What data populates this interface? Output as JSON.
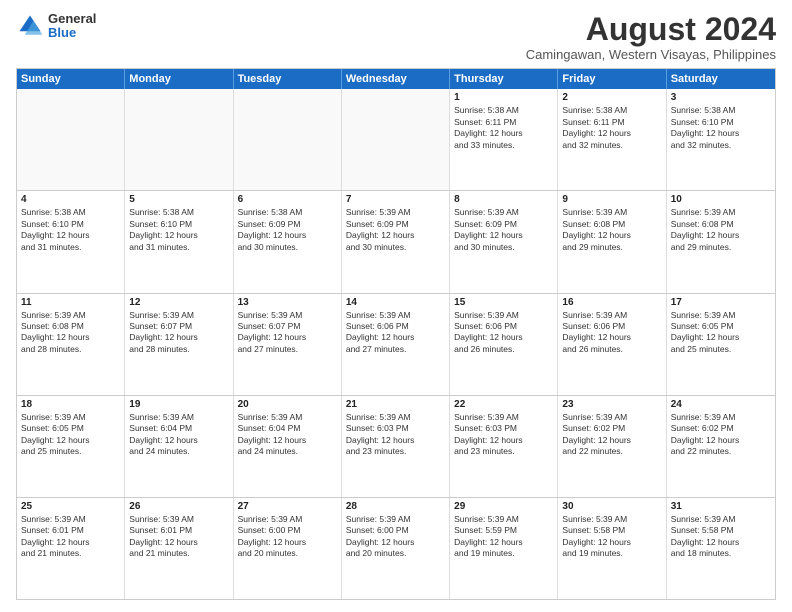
{
  "logo": {
    "general": "General",
    "blue": "Blue"
  },
  "title": "August 2024",
  "subtitle": "Camingawan, Western Visayas, Philippines",
  "headers": [
    "Sunday",
    "Monday",
    "Tuesday",
    "Wednesday",
    "Thursday",
    "Friday",
    "Saturday"
  ],
  "weeks": [
    [
      {
        "day": "",
        "info": "",
        "empty": true
      },
      {
        "day": "",
        "info": "",
        "empty": true
      },
      {
        "day": "",
        "info": "",
        "empty": true
      },
      {
        "day": "",
        "info": "",
        "empty": true
      },
      {
        "day": "1",
        "info": "Sunrise: 5:38 AM\nSunset: 6:11 PM\nDaylight: 12 hours\nand 33 minutes.",
        "empty": false
      },
      {
        "day": "2",
        "info": "Sunrise: 5:38 AM\nSunset: 6:11 PM\nDaylight: 12 hours\nand 32 minutes.",
        "empty": false
      },
      {
        "day": "3",
        "info": "Sunrise: 5:38 AM\nSunset: 6:10 PM\nDaylight: 12 hours\nand 32 minutes.",
        "empty": false
      }
    ],
    [
      {
        "day": "4",
        "info": "Sunrise: 5:38 AM\nSunset: 6:10 PM\nDaylight: 12 hours\nand 31 minutes.",
        "empty": false
      },
      {
        "day": "5",
        "info": "Sunrise: 5:38 AM\nSunset: 6:10 PM\nDaylight: 12 hours\nand 31 minutes.",
        "empty": false
      },
      {
        "day": "6",
        "info": "Sunrise: 5:38 AM\nSunset: 6:09 PM\nDaylight: 12 hours\nand 30 minutes.",
        "empty": false
      },
      {
        "day": "7",
        "info": "Sunrise: 5:39 AM\nSunset: 6:09 PM\nDaylight: 12 hours\nand 30 minutes.",
        "empty": false
      },
      {
        "day": "8",
        "info": "Sunrise: 5:39 AM\nSunset: 6:09 PM\nDaylight: 12 hours\nand 30 minutes.",
        "empty": false
      },
      {
        "day": "9",
        "info": "Sunrise: 5:39 AM\nSunset: 6:08 PM\nDaylight: 12 hours\nand 29 minutes.",
        "empty": false
      },
      {
        "day": "10",
        "info": "Sunrise: 5:39 AM\nSunset: 6:08 PM\nDaylight: 12 hours\nand 29 minutes.",
        "empty": false
      }
    ],
    [
      {
        "day": "11",
        "info": "Sunrise: 5:39 AM\nSunset: 6:08 PM\nDaylight: 12 hours\nand 28 minutes.",
        "empty": false
      },
      {
        "day": "12",
        "info": "Sunrise: 5:39 AM\nSunset: 6:07 PM\nDaylight: 12 hours\nand 28 minutes.",
        "empty": false
      },
      {
        "day": "13",
        "info": "Sunrise: 5:39 AM\nSunset: 6:07 PM\nDaylight: 12 hours\nand 27 minutes.",
        "empty": false
      },
      {
        "day": "14",
        "info": "Sunrise: 5:39 AM\nSunset: 6:06 PM\nDaylight: 12 hours\nand 27 minutes.",
        "empty": false
      },
      {
        "day": "15",
        "info": "Sunrise: 5:39 AM\nSunset: 6:06 PM\nDaylight: 12 hours\nand 26 minutes.",
        "empty": false
      },
      {
        "day": "16",
        "info": "Sunrise: 5:39 AM\nSunset: 6:06 PM\nDaylight: 12 hours\nand 26 minutes.",
        "empty": false
      },
      {
        "day": "17",
        "info": "Sunrise: 5:39 AM\nSunset: 6:05 PM\nDaylight: 12 hours\nand 25 minutes.",
        "empty": false
      }
    ],
    [
      {
        "day": "18",
        "info": "Sunrise: 5:39 AM\nSunset: 6:05 PM\nDaylight: 12 hours\nand 25 minutes.",
        "empty": false
      },
      {
        "day": "19",
        "info": "Sunrise: 5:39 AM\nSunset: 6:04 PM\nDaylight: 12 hours\nand 24 minutes.",
        "empty": false
      },
      {
        "day": "20",
        "info": "Sunrise: 5:39 AM\nSunset: 6:04 PM\nDaylight: 12 hours\nand 24 minutes.",
        "empty": false
      },
      {
        "day": "21",
        "info": "Sunrise: 5:39 AM\nSunset: 6:03 PM\nDaylight: 12 hours\nand 23 minutes.",
        "empty": false
      },
      {
        "day": "22",
        "info": "Sunrise: 5:39 AM\nSunset: 6:03 PM\nDaylight: 12 hours\nand 23 minutes.",
        "empty": false
      },
      {
        "day": "23",
        "info": "Sunrise: 5:39 AM\nSunset: 6:02 PM\nDaylight: 12 hours\nand 22 minutes.",
        "empty": false
      },
      {
        "day": "24",
        "info": "Sunrise: 5:39 AM\nSunset: 6:02 PM\nDaylight: 12 hours\nand 22 minutes.",
        "empty": false
      }
    ],
    [
      {
        "day": "25",
        "info": "Sunrise: 5:39 AM\nSunset: 6:01 PM\nDaylight: 12 hours\nand 21 minutes.",
        "empty": false
      },
      {
        "day": "26",
        "info": "Sunrise: 5:39 AM\nSunset: 6:01 PM\nDaylight: 12 hours\nand 21 minutes.",
        "empty": false
      },
      {
        "day": "27",
        "info": "Sunrise: 5:39 AM\nSunset: 6:00 PM\nDaylight: 12 hours\nand 20 minutes.",
        "empty": false
      },
      {
        "day": "28",
        "info": "Sunrise: 5:39 AM\nSunset: 6:00 PM\nDaylight: 12 hours\nand 20 minutes.",
        "empty": false
      },
      {
        "day": "29",
        "info": "Sunrise: 5:39 AM\nSunset: 5:59 PM\nDaylight: 12 hours\nand 19 minutes.",
        "empty": false
      },
      {
        "day": "30",
        "info": "Sunrise: 5:39 AM\nSunset: 5:58 PM\nDaylight: 12 hours\nand 19 minutes.",
        "empty": false
      },
      {
        "day": "31",
        "info": "Sunrise: 5:39 AM\nSunset: 5:58 PM\nDaylight: 12 hours\nand 18 minutes.",
        "empty": false
      }
    ]
  ]
}
